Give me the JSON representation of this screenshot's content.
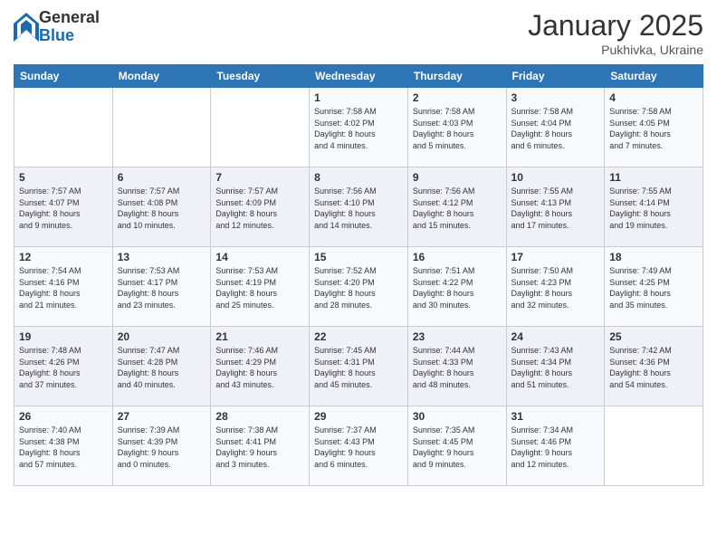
{
  "logo": {
    "general": "General",
    "blue": "Blue"
  },
  "header": {
    "title": "January 2025",
    "location": "Pukhivka, Ukraine"
  },
  "weekdays": [
    "Sunday",
    "Monday",
    "Tuesday",
    "Wednesday",
    "Thursday",
    "Friday",
    "Saturday"
  ],
  "weeks": [
    [
      {
        "day": "",
        "info": ""
      },
      {
        "day": "",
        "info": ""
      },
      {
        "day": "",
        "info": ""
      },
      {
        "day": "1",
        "info": "Sunrise: 7:58 AM\nSunset: 4:02 PM\nDaylight: 8 hours\nand 4 minutes."
      },
      {
        "day": "2",
        "info": "Sunrise: 7:58 AM\nSunset: 4:03 PM\nDaylight: 8 hours\nand 5 minutes."
      },
      {
        "day": "3",
        "info": "Sunrise: 7:58 AM\nSunset: 4:04 PM\nDaylight: 8 hours\nand 6 minutes."
      },
      {
        "day": "4",
        "info": "Sunrise: 7:58 AM\nSunset: 4:05 PM\nDaylight: 8 hours\nand 7 minutes."
      }
    ],
    [
      {
        "day": "5",
        "info": "Sunrise: 7:57 AM\nSunset: 4:07 PM\nDaylight: 8 hours\nand 9 minutes."
      },
      {
        "day": "6",
        "info": "Sunrise: 7:57 AM\nSunset: 4:08 PM\nDaylight: 8 hours\nand 10 minutes."
      },
      {
        "day": "7",
        "info": "Sunrise: 7:57 AM\nSunset: 4:09 PM\nDaylight: 8 hours\nand 12 minutes."
      },
      {
        "day": "8",
        "info": "Sunrise: 7:56 AM\nSunset: 4:10 PM\nDaylight: 8 hours\nand 14 minutes."
      },
      {
        "day": "9",
        "info": "Sunrise: 7:56 AM\nSunset: 4:12 PM\nDaylight: 8 hours\nand 15 minutes."
      },
      {
        "day": "10",
        "info": "Sunrise: 7:55 AM\nSunset: 4:13 PM\nDaylight: 8 hours\nand 17 minutes."
      },
      {
        "day": "11",
        "info": "Sunrise: 7:55 AM\nSunset: 4:14 PM\nDaylight: 8 hours\nand 19 minutes."
      }
    ],
    [
      {
        "day": "12",
        "info": "Sunrise: 7:54 AM\nSunset: 4:16 PM\nDaylight: 8 hours\nand 21 minutes."
      },
      {
        "day": "13",
        "info": "Sunrise: 7:53 AM\nSunset: 4:17 PM\nDaylight: 8 hours\nand 23 minutes."
      },
      {
        "day": "14",
        "info": "Sunrise: 7:53 AM\nSunset: 4:19 PM\nDaylight: 8 hours\nand 25 minutes."
      },
      {
        "day": "15",
        "info": "Sunrise: 7:52 AM\nSunset: 4:20 PM\nDaylight: 8 hours\nand 28 minutes."
      },
      {
        "day": "16",
        "info": "Sunrise: 7:51 AM\nSunset: 4:22 PM\nDaylight: 8 hours\nand 30 minutes."
      },
      {
        "day": "17",
        "info": "Sunrise: 7:50 AM\nSunset: 4:23 PM\nDaylight: 8 hours\nand 32 minutes."
      },
      {
        "day": "18",
        "info": "Sunrise: 7:49 AM\nSunset: 4:25 PM\nDaylight: 8 hours\nand 35 minutes."
      }
    ],
    [
      {
        "day": "19",
        "info": "Sunrise: 7:48 AM\nSunset: 4:26 PM\nDaylight: 8 hours\nand 37 minutes."
      },
      {
        "day": "20",
        "info": "Sunrise: 7:47 AM\nSunset: 4:28 PM\nDaylight: 8 hours\nand 40 minutes."
      },
      {
        "day": "21",
        "info": "Sunrise: 7:46 AM\nSunset: 4:29 PM\nDaylight: 8 hours\nand 43 minutes."
      },
      {
        "day": "22",
        "info": "Sunrise: 7:45 AM\nSunset: 4:31 PM\nDaylight: 8 hours\nand 45 minutes."
      },
      {
        "day": "23",
        "info": "Sunrise: 7:44 AM\nSunset: 4:33 PM\nDaylight: 8 hours\nand 48 minutes."
      },
      {
        "day": "24",
        "info": "Sunrise: 7:43 AM\nSunset: 4:34 PM\nDaylight: 8 hours\nand 51 minutes."
      },
      {
        "day": "25",
        "info": "Sunrise: 7:42 AM\nSunset: 4:36 PM\nDaylight: 8 hours\nand 54 minutes."
      }
    ],
    [
      {
        "day": "26",
        "info": "Sunrise: 7:40 AM\nSunset: 4:38 PM\nDaylight: 8 hours\nand 57 minutes."
      },
      {
        "day": "27",
        "info": "Sunrise: 7:39 AM\nSunset: 4:39 PM\nDaylight: 9 hours\nand 0 minutes."
      },
      {
        "day": "28",
        "info": "Sunrise: 7:38 AM\nSunset: 4:41 PM\nDaylight: 9 hours\nand 3 minutes."
      },
      {
        "day": "29",
        "info": "Sunrise: 7:37 AM\nSunset: 4:43 PM\nDaylight: 9 hours\nand 6 minutes."
      },
      {
        "day": "30",
        "info": "Sunrise: 7:35 AM\nSunset: 4:45 PM\nDaylight: 9 hours\nand 9 minutes."
      },
      {
        "day": "31",
        "info": "Sunrise: 7:34 AM\nSunset: 4:46 PM\nDaylight: 9 hours\nand 12 minutes."
      },
      {
        "day": "",
        "info": ""
      }
    ]
  ]
}
